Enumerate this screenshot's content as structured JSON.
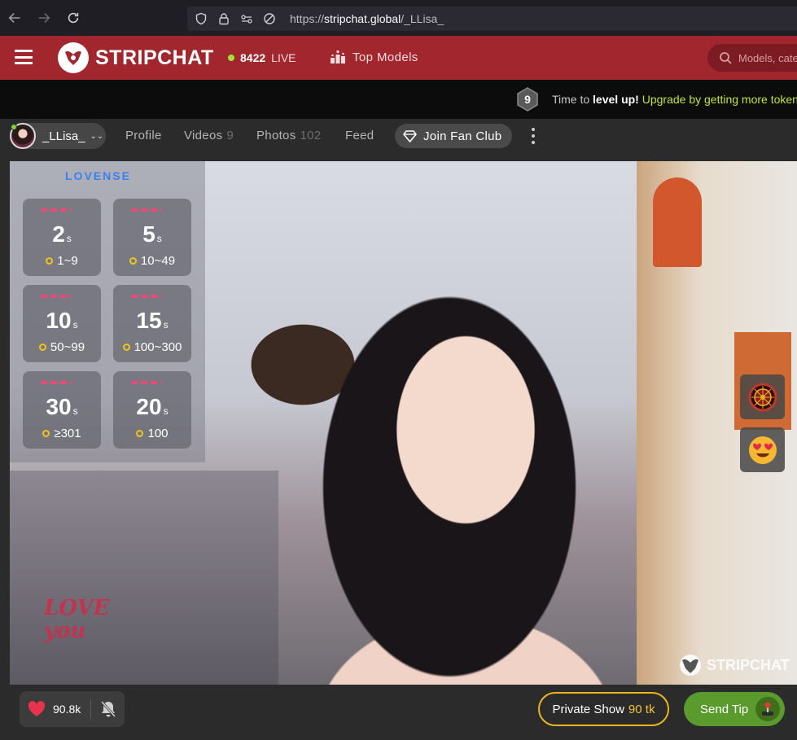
{
  "browser": {
    "url_prefix": "https://",
    "url_domain": "stripchat.global",
    "url_path": "/_LLisa_"
  },
  "header": {
    "logo_text": "STRIPCHAT",
    "live_count": "8422",
    "live_label": "LIVE",
    "top_models_label": "Top Models",
    "search_placeholder": "Models, categories",
    "brand_color": "#a2262e"
  },
  "level_bar": {
    "level": "9",
    "text_prefix": "Time to ",
    "text_bold": "level up!",
    "text_link": "Upgrade by getting more tokens"
  },
  "model_nav": {
    "model_name": "_LLisa_",
    "tabs": [
      {
        "label": "Profile",
        "count": ""
      },
      {
        "label": "Videos",
        "count": "9"
      },
      {
        "label": "Photos",
        "count": "102"
      },
      {
        "label": "Feed",
        "count": ""
      }
    ],
    "fan_club_label": "Join Fan Club"
  },
  "lovense": {
    "title": "LOVENSE",
    "tiers": [
      {
        "seconds": "2",
        "unit": "s",
        "range": "1~9"
      },
      {
        "seconds": "5",
        "unit": "s",
        "range": "10~49"
      },
      {
        "seconds": "10",
        "unit": "s",
        "range": "50~99"
      },
      {
        "seconds": "15",
        "unit": "s",
        "range": "100~300"
      },
      {
        "seconds": "30",
        "unit": "s",
        "range": "≥301"
      },
      {
        "seconds": "20",
        "unit": "s",
        "range": "100"
      }
    ]
  },
  "video": {
    "watermark": "STRIPCHAT",
    "overlay_text_line1": "LOVE",
    "overlay_text_line2": "you"
  },
  "controls": {
    "like_count": "90.8k",
    "private_show_label": "Private Show",
    "private_show_price": "90 tk",
    "send_tip_label": "Send Tip"
  }
}
